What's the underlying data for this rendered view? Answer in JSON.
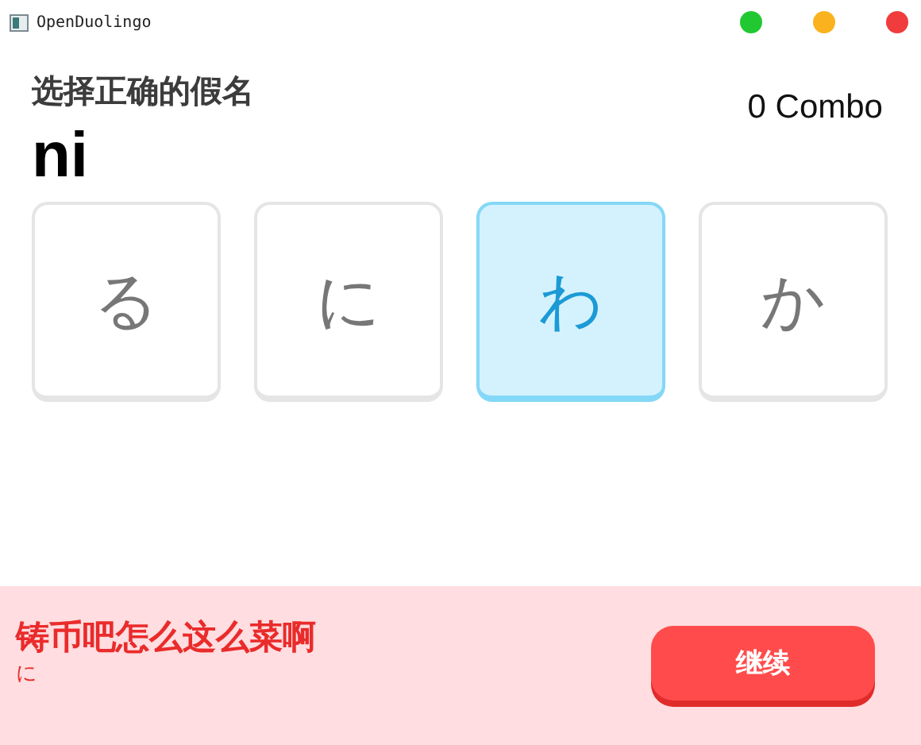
{
  "window": {
    "title": "OpenDuolingo",
    "controls": [
      {
        "color": "#22c832"
      },
      {
        "color": "#fab31e"
      },
      {
        "color": "#f03c3c"
      }
    ]
  },
  "prompt": {
    "instruction": "选择正确的假名",
    "combo": "0 Combo",
    "romaji": "ni"
  },
  "choices": [
    {
      "label": "る",
      "selected": false
    },
    {
      "label": "に",
      "selected": false
    },
    {
      "label": "わ",
      "selected": true
    },
    {
      "label": "か",
      "selected": false
    }
  ],
  "feedback": {
    "message": "铸币吧怎么这么菜啊",
    "answer": "に",
    "button": "继续"
  }
}
